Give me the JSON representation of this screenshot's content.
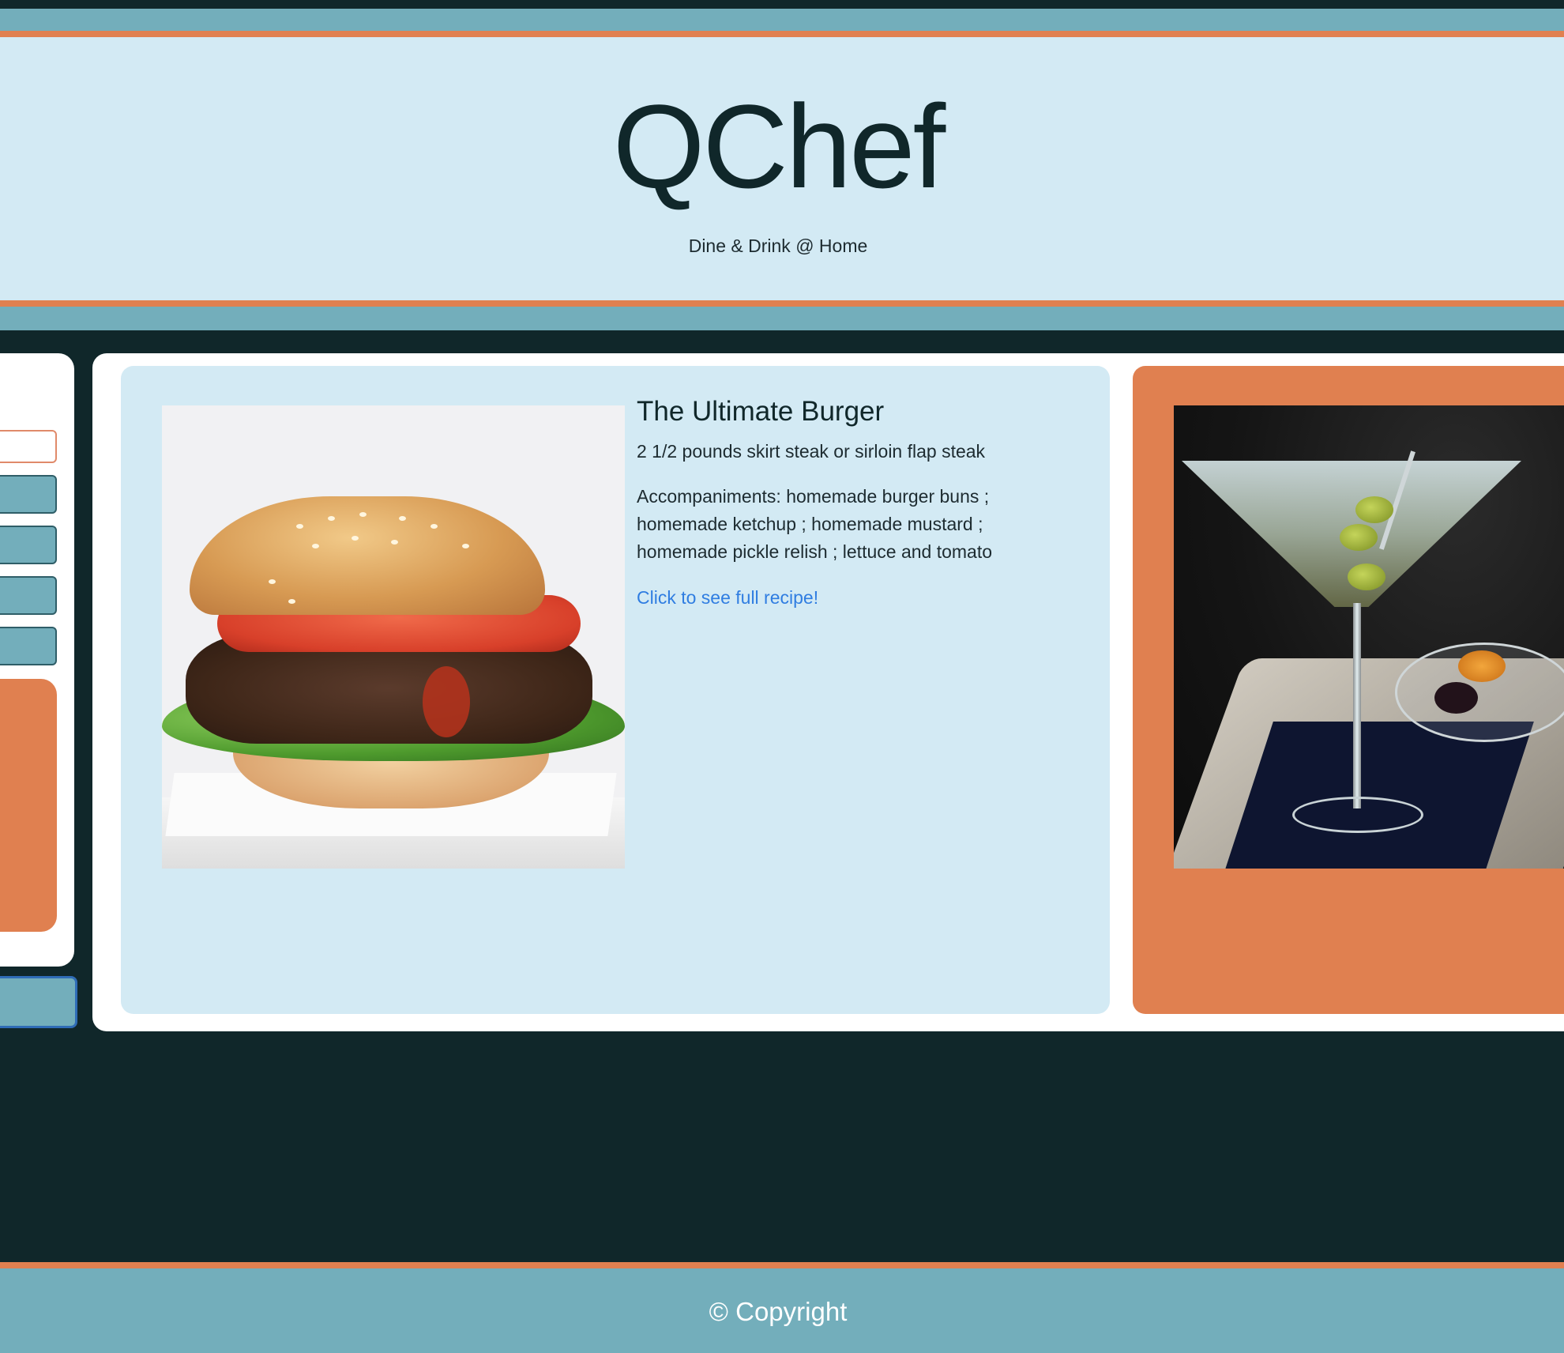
{
  "header": {
    "title": "QChef",
    "tagline": "Dine & Drink @ Home"
  },
  "recipes": [
    {
      "title": "The Ultimate Burger",
      "ingredient": "2 1/2 pounds skirt steak or sirloin flap steak",
      "accompaniments": "Accompaniments: homemade burger buns ; homemade ketchup ; homemade mustard ; homemade pickle relish ; lettuce and tomato",
      "link_label": "Click to see full recipe!",
      "image_icon": "burger-photo"
    },
    {
      "image_icon": "martini-photo"
    }
  ],
  "footer": {
    "copyright": "© Copyright"
  },
  "colors": {
    "dark": "#10272a",
    "teal": "#73aebb",
    "orange": "#e08050",
    "light_blue": "#d3eaf4",
    "link": "#2f7de1"
  }
}
